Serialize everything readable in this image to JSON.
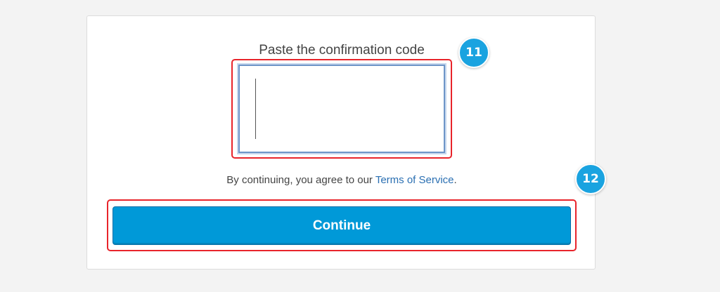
{
  "form": {
    "code_label": "Paste the confirmation code",
    "code_value": "",
    "agree_prefix": "By continuing, you agree to our ",
    "terms_link": "Terms of Service",
    "agree_suffix": ".",
    "continue_label": "Continue"
  },
  "annotations": {
    "step_code": "11",
    "step_continue": "12"
  },
  "colors": {
    "highlight": "#e8242b",
    "badge": "#1aa3e0",
    "button": "#0099d8",
    "link": "#2a6fb2"
  }
}
